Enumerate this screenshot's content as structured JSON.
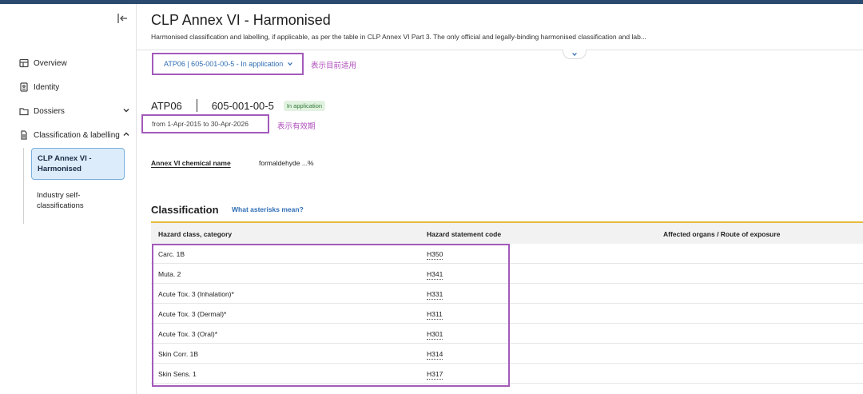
{
  "sidebar": {
    "items": [
      {
        "label": "Overview",
        "icon": "overview-icon"
      },
      {
        "label": "Identity",
        "icon": "identity-icon"
      },
      {
        "label": "Dossiers",
        "icon": "dossiers-icon"
      },
      {
        "label": "Classification & labelling",
        "icon": "classification-icon"
      }
    ],
    "sub_items": [
      {
        "label": "CLP Annex VI - Harmonised",
        "active": true
      },
      {
        "label": "Industry self-classifications",
        "active": false
      }
    ]
  },
  "header": {
    "title": "CLP Annex VI - Harmonised",
    "description": "Harmonised classification and labelling, if applicable, as per the table in CLP Annex VI Part 3. The only official and legally-binding harmonised classification and lab..."
  },
  "selector": {
    "value": "ATP06 | 605-001-00-5 - In application"
  },
  "annotations": {
    "current": "表示目前适用",
    "validity": "表示有效期"
  },
  "entry": {
    "atp": "ATP06",
    "index": "605-001-00-5",
    "status": "In application",
    "validity": "from 1-Apr-2015 to 30-Apr-2026"
  },
  "chemical": {
    "label": "Annex VI chemical name",
    "value": "formaldehyde ...%"
  },
  "classification": {
    "title": "Classification",
    "link": "What asterisks mean?",
    "columns": [
      "Hazard class, category",
      "Hazard statement code",
      "Affected organs / Route of exposure"
    ],
    "rows": [
      {
        "hazard_class": "Carc. 1B",
        "code": "H350",
        "organs": ""
      },
      {
        "hazard_class": "Muta. 2",
        "code": "H341",
        "organs": ""
      },
      {
        "hazard_class": "Acute Tox. 3 (Inhalation)*",
        "code": "H331",
        "organs": ""
      },
      {
        "hazard_class": "Acute Tox. 3 (Dermal)*",
        "code": "H311",
        "organs": ""
      },
      {
        "hazard_class": "Acute Tox. 3 (Oral)*",
        "code": "H301",
        "organs": ""
      },
      {
        "hazard_class": "Skin Corr. 1B",
        "code": "H314",
        "organs": ""
      },
      {
        "hazard_class": "Skin Sens. 1",
        "code": "H317",
        "organs": ""
      }
    ]
  },
  "colors": {
    "accent": "#2f6db5",
    "annotation": "#a35aba",
    "table_accent": "#e8b93a",
    "status_bg": "#e2f2e1"
  }
}
